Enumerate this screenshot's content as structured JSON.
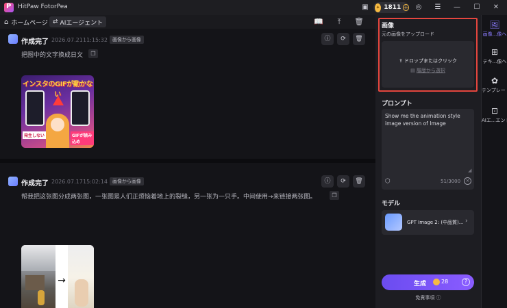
{
  "app": {
    "title": "HitPaw FotorPea",
    "credits": "1811"
  },
  "toolbar": {
    "home_label": "ホームページ",
    "agent_label": "AIエージェント"
  },
  "feed": {
    "cards": [
      {
        "title": "作成完了",
        "date": "2026.07.21",
        "time": "11:15:32",
        "tag": "画像から画像",
        "prompt": "把图中的文字换成日文",
        "image_text": {
          "banner": "インスタのGIFが動かない",
          "left_label": "発生しない",
          "right_label": "GIFが読み込め"
        }
      },
      {
        "title": "作成完了",
        "date": "2026.07.17",
        "time": "15:02:14",
        "tag": "画像から画像",
        "prompt": "帮我把这张图分成两张图，一张图是人们正烦恼着地上的裂缝，另一张为一只手。中间使用→来链接两张图。",
        "image_text": {
          "arrow": "→"
        }
      }
    ]
  },
  "panel": {
    "image": {
      "section_label": "画像",
      "upload_label": "元の画像をアップロード",
      "drop_text": "ドロップまたはクリック",
      "history_link": "履歴から選択"
    },
    "prompt": {
      "section_label": "プロンプト",
      "value": "Show me the animation style image version of Image",
      "counter": "51/3000"
    },
    "model": {
      "section_label": "モデル",
      "name": "GPT Image 2: (中品質)..."
    },
    "generate": {
      "label": "生成",
      "cost": "28"
    },
    "disclaimer": "免責事項"
  },
  "rail": {
    "items": [
      {
        "label": "画像...像へ",
        "icon": "image-icon",
        "active": true
      },
      {
        "label": "テキ...像へ",
        "icon": "text-to-image-icon",
        "active": false
      },
      {
        "label": "テンプレート",
        "icon": "template-icon",
        "active": false
      },
      {
        "label": "AIエ...エント",
        "icon": "ai-agent-icon",
        "active": false
      }
    ]
  },
  "colors": {
    "accent": "#8a5cff",
    "highlight": "#e5463e",
    "coin": "#f5b942"
  }
}
